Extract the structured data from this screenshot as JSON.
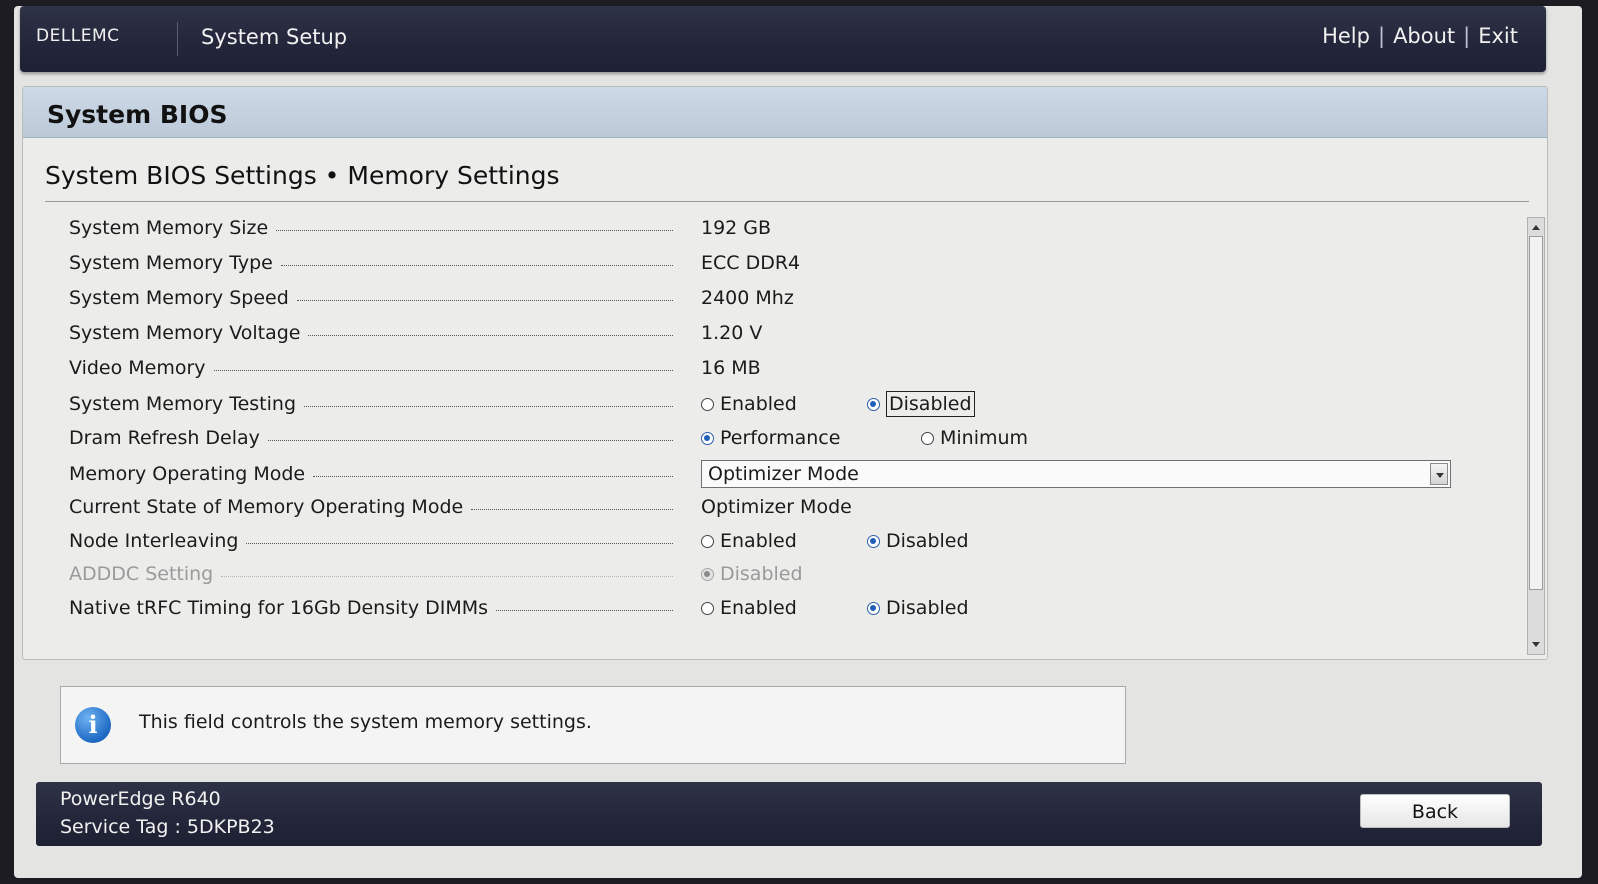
{
  "header": {
    "logo": "DELLEMC",
    "title": "System Setup",
    "links": [
      "Help",
      "About",
      "Exit"
    ]
  },
  "panel": {
    "title": "System BIOS",
    "section_title": "System BIOS Settings • Memory Settings"
  },
  "settings": [
    {
      "label": "System Memory Size",
      "value": "192 GB"
    },
    {
      "label": "System Memory Type",
      "value": "ECC DDR4"
    },
    {
      "label": "System Memory Speed",
      "value": "2400 Mhz"
    },
    {
      "label": "System Memory Voltage",
      "value": "1.20 V"
    },
    {
      "label": "Video Memory",
      "value": "16 MB"
    },
    {
      "label": "System Memory Testing",
      "options": [
        "Enabled",
        "Disabled"
      ],
      "selected": "Disabled"
    },
    {
      "label": "Dram Refresh Delay",
      "options": [
        "Performance",
        "Minimum"
      ],
      "selected": "Performance"
    },
    {
      "label": "Memory Operating Mode",
      "dropdown_value": "Optimizer Mode"
    },
    {
      "label": "Current State of Memory Operating Mode",
      "value": "Optimizer Mode"
    },
    {
      "label": "Node Interleaving",
      "options": [
        "Enabled",
        "Disabled"
      ],
      "selected": "Disabled"
    },
    {
      "label": "ADDDC Setting",
      "options": [
        "Disabled"
      ],
      "selected": "Disabled",
      "disabled": true
    },
    {
      "label": "Native tRFC Timing for 16Gb Density DIMMs",
      "options": [
        "Enabled",
        "Disabled"
      ],
      "selected": "Disabled"
    }
  ],
  "help": {
    "icon": "info-icon",
    "text": "This field controls the system memory settings."
  },
  "footer": {
    "model": "PowerEdge R640",
    "service_tag": "Service Tag : 5DKPB23",
    "back_label": "Back"
  },
  "colors": {
    "bar_dark": "#23263a",
    "panel_header": "#c4d1df",
    "radio_selected": "#1f5fb8"
  }
}
